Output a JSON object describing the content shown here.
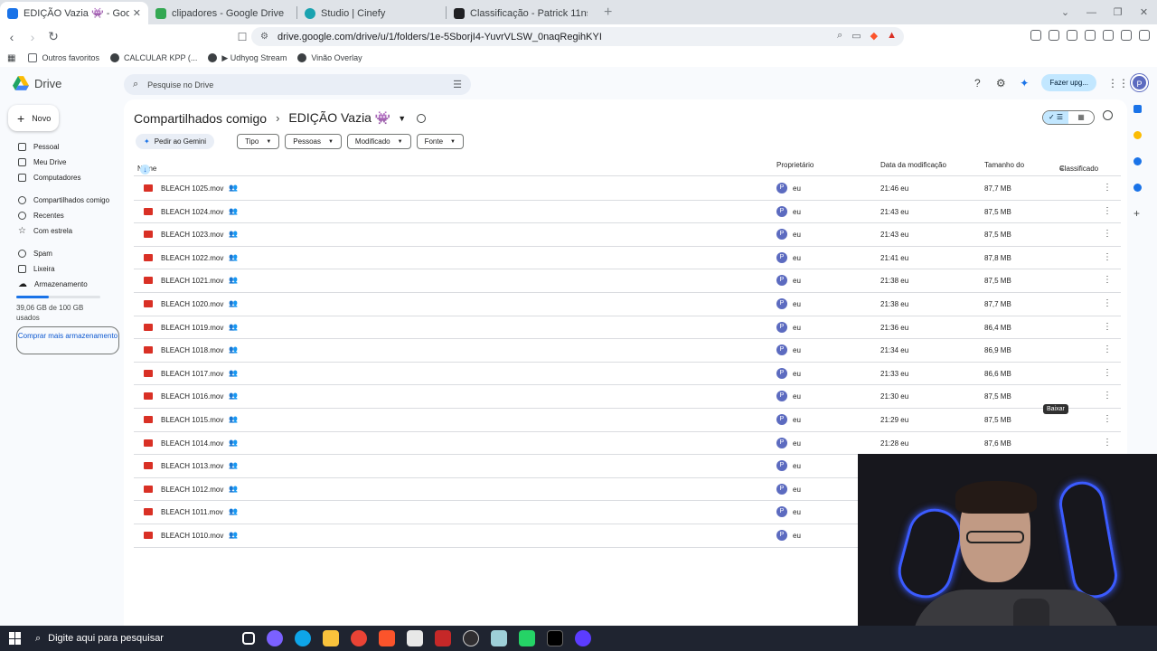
{
  "browser": {
    "tabs": [
      {
        "title": "EDIÇÃO Vazia 👾 - Google Drive",
        "color": "#1a73e8",
        "active": true
      },
      {
        "title": "clipadores - Google Drive",
        "color": "#34a853",
        "active": false
      },
      {
        "title": "Studio | Cinefy",
        "color": "#1aa3b0",
        "active": false
      },
      {
        "title": "Classificação - Patrick 11ns",
        "color": "#202124",
        "active": false
      }
    ],
    "url": "drive.google.com/drive/u/1/folders/1e-5SborjI4-YuvrVLSW_0naqRegihKYI",
    "bookmarks": [
      "Outros favoritos",
      "CALCULAR KPP (...",
      "▶ Udhyog Stream",
      "Vinão Overlay"
    ]
  },
  "drive": {
    "app_name": "Drive",
    "search_placeholder": "Pesquise no Drive",
    "upgrade_label": "Fazer upg...",
    "avatar_letter": "P",
    "new_label": "Novo",
    "nav": [
      {
        "label": "Pessoal",
        "icon": "home-icon"
      },
      {
        "label": "Meu Drive",
        "icon": "drive-icon"
      },
      {
        "label": "Computadores",
        "icon": "computer-icon"
      },
      {
        "label": "Compartilhados comigo",
        "icon": "people-icon"
      },
      {
        "label": "Recentes",
        "icon": "clock-icon"
      },
      {
        "label": "Com estrela",
        "icon": "star-icon"
      },
      {
        "label": "Spam",
        "icon": "spam-icon"
      },
      {
        "label": "Lixeira",
        "icon": "trash-icon"
      },
      {
        "label": "Armazenamento",
        "icon": "cloud-icon"
      }
    ],
    "storage": {
      "text": "39,06 GB de 100 GB usados",
      "fraction": 0.39
    },
    "buy_storage_label": "Comprar mais armazenamento",
    "breadcrumb": {
      "parent": "Compartilhados comigo",
      "current": "EDIÇÃO Vazia 👾"
    },
    "gemini_label": "Pedir ao Gemini",
    "filters": [
      "Tipo",
      "Pessoas",
      "Modificado",
      "Fonte"
    ],
    "columns": {
      "name": "Nome",
      "owner": "Proprietário",
      "modified": "Data da modificação",
      "size": "Tamanho do",
      "sort": "Classificado"
    },
    "tooltip": "Baixar",
    "files": [
      {
        "name": "BLEACH 1025.mov",
        "owner": "eu",
        "modified": "21:46 eu",
        "size": "87,7 MB"
      },
      {
        "name": "BLEACH 1024.mov",
        "owner": "eu",
        "modified": "21:43 eu",
        "size": "87,5 MB"
      },
      {
        "name": "BLEACH 1023.mov",
        "owner": "eu",
        "modified": "21:43 eu",
        "size": "87,5 MB"
      },
      {
        "name": "BLEACH 1022.mov",
        "owner": "eu",
        "modified": "21:41 eu",
        "size": "87,8 MB"
      },
      {
        "name": "BLEACH 1021.mov",
        "owner": "eu",
        "modified": "21:38 eu",
        "size": "87,5 MB"
      },
      {
        "name": "BLEACH 1020.mov",
        "owner": "eu",
        "modified": "21:38 eu",
        "size": "87,7 MB"
      },
      {
        "name": "BLEACH 1019.mov",
        "owner": "eu",
        "modified": "21:36 eu",
        "size": "86,4 MB"
      },
      {
        "name": "BLEACH 1018.mov",
        "owner": "eu",
        "modified": "21:34 eu",
        "size": "86,9 MB"
      },
      {
        "name": "BLEACH 1017.mov",
        "owner": "eu",
        "modified": "21:33 eu",
        "size": "86,6 MB"
      },
      {
        "name": "BLEACH 1016.mov",
        "owner": "eu",
        "modified": "21:30 eu",
        "size": "87,5 MB"
      },
      {
        "name": "BLEACH 1015.mov",
        "owner": "eu",
        "modified": "21:29 eu",
        "size": "87,5 MB"
      },
      {
        "name": "BLEACH 1014.mov",
        "owner": "eu",
        "modified": "21:28 eu",
        "size": "87,6 MB"
      },
      {
        "name": "BLEACH 1013.mov",
        "owner": "eu",
        "modified": "",
        "size": ""
      },
      {
        "name": "BLEACH 1012.mov",
        "owner": "eu",
        "modified": "",
        "size": ""
      },
      {
        "name": "BLEACH 1011.mov",
        "owner": "eu",
        "modified": "",
        "size": ""
      },
      {
        "name": "BLEACH 1010.mov",
        "owner": "eu",
        "modified": "",
        "size": ""
      }
    ]
  },
  "taskbar": {
    "search_placeholder": "Digite aqui para pesquisar",
    "apps": [
      "task-view-icon",
      "copilot-icon",
      "edge-icon",
      "file-explorer-icon",
      "chrome-icon",
      "brave-icon",
      "vegas-icon",
      "app-icon",
      "obs-icon",
      "app-icon",
      "whatsapp-icon",
      "capcut-icon",
      "app-icon"
    ]
  }
}
